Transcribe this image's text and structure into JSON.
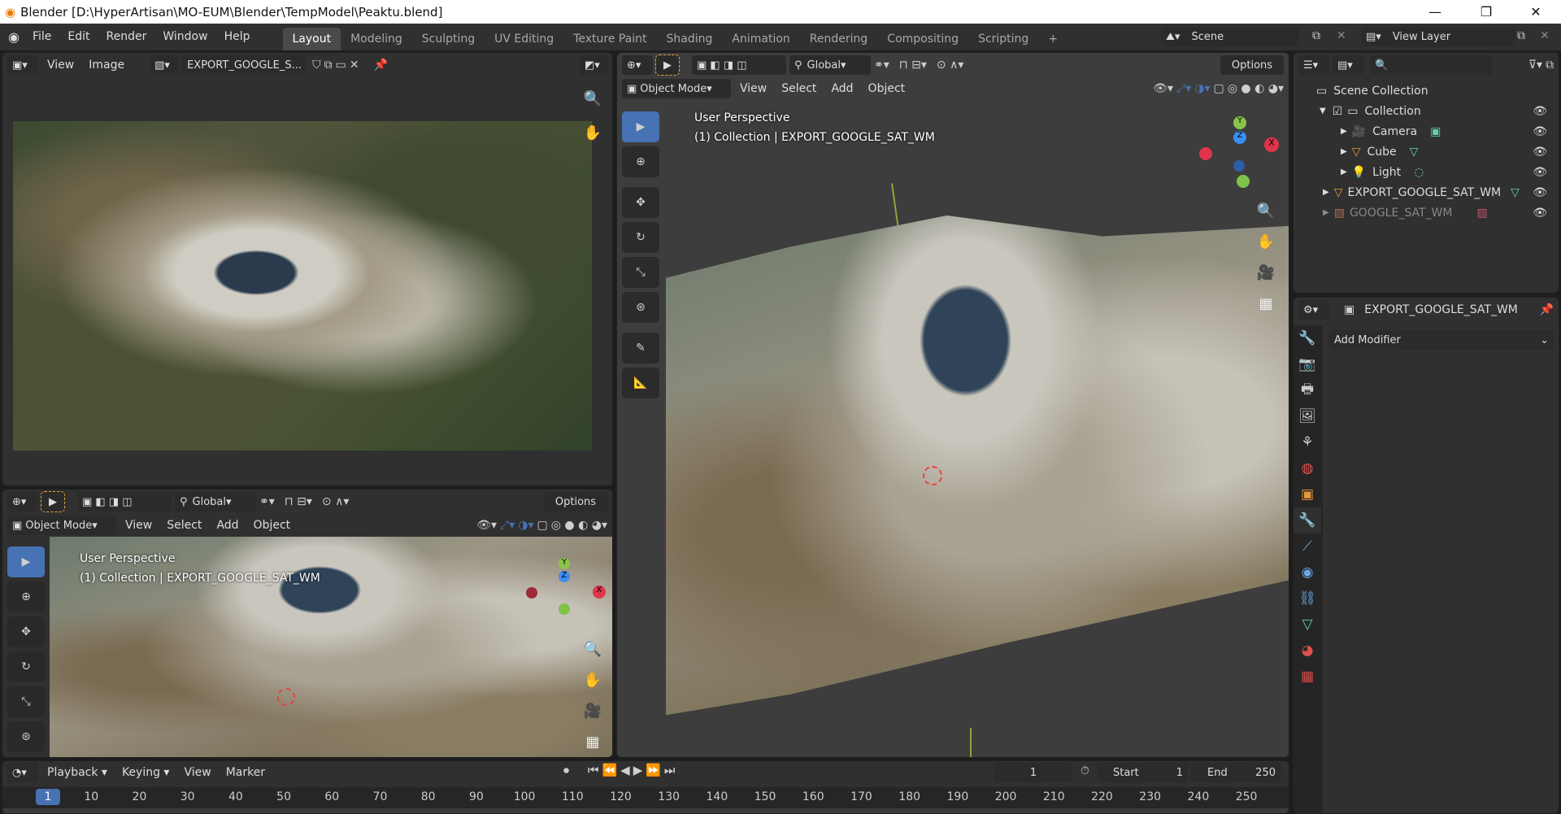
{
  "window": {
    "title": "Blender [D:\\HyperArtisan\\MO-EUM\\Blender\\TempModel\\Peaktu.blend]",
    "minimize": "—",
    "maximize": "❐",
    "close": "✕"
  },
  "menubar": {
    "items": [
      "File",
      "Edit",
      "Render",
      "Window",
      "Help"
    ]
  },
  "workspaces": {
    "tabs": [
      "Layout",
      "Modeling",
      "Sculpting",
      "UV Editing",
      "Texture Paint",
      "Shading",
      "Animation",
      "Rendering",
      "Compositing",
      "Scripting"
    ],
    "active": "Layout",
    "add": "+"
  },
  "scene": {
    "label": "Scene",
    "view_layer": "View Layer"
  },
  "image_editor": {
    "view": "View",
    "image": "Image",
    "image_name": "EXPORT_GOOGLE_S..."
  },
  "viewport_main": {
    "transform": "Global",
    "options": "Options",
    "mode": "Object Mode",
    "menus": [
      "View",
      "Select",
      "Add",
      "Object"
    ],
    "perspective": "User Perspective",
    "collection_info": "(1) Collection | EXPORT_GOOGLE_SAT_WM"
  },
  "viewport_small": {
    "transform": "Global",
    "options": "Options",
    "mode": "Object Mode",
    "menus": [
      "View",
      "Select",
      "Add",
      "Object"
    ],
    "perspective": "User Perspective",
    "collection_info": "(1) Collection | EXPORT_GOOGLE_SAT_WM"
  },
  "gizmo": {
    "x": "X",
    "y": "Y",
    "z": "Z"
  },
  "outliner": {
    "scene_collection": "Scene Collection",
    "collection": "Collection",
    "items": [
      "Camera",
      "Cube",
      "Light",
      "EXPORT_GOOGLE_SAT_WM",
      "GOOGLE_SAT_WM"
    ]
  },
  "properties": {
    "object_name": "EXPORT_GOOGLE_SAT_WM",
    "add_modifier": "Add Modifier"
  },
  "timeline": {
    "menus": [
      "Playback",
      "Keying",
      "View",
      "Marker"
    ],
    "current_frame": "1",
    "start_label": "Start",
    "start": "1",
    "end_label": "End",
    "end": "250",
    "ticks": [
      "1",
      "10",
      "20",
      "30",
      "40",
      "50",
      "60",
      "70",
      "80",
      "90",
      "100",
      "110",
      "120",
      "130",
      "140",
      "150",
      "160",
      "170",
      "180",
      "190",
      "200",
      "210",
      "220",
      "230",
      "240",
      "250"
    ]
  },
  "colors": {
    "accent": "#4772b3",
    "background": "#1d1d1d",
    "panel": "#303030",
    "grid": "#3d3d3d"
  }
}
